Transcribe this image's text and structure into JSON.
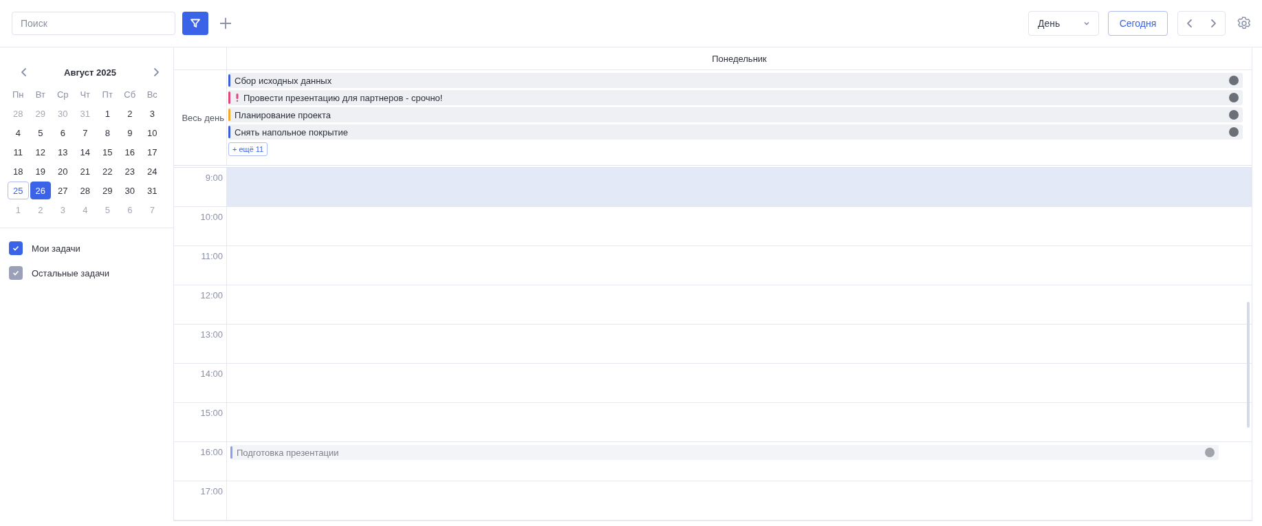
{
  "toolbar": {
    "search": {
      "placeholder": "Поиск"
    },
    "filter_active": true,
    "view_select": {
      "value": "День"
    },
    "today_button": "Сегодня"
  },
  "mini_calendar": {
    "title": "Август 2025",
    "weekdays": [
      "Пн",
      "Вт",
      "Ср",
      "Чт",
      "Пт",
      "Сб",
      "Вс"
    ],
    "weeks": [
      [
        {
          "label": "28",
          "outside": true,
          "today": false,
          "selected": false
        },
        {
          "label": "29",
          "outside": true,
          "today": false,
          "selected": false
        },
        {
          "label": "30",
          "outside": true,
          "today": false,
          "selected": false
        },
        {
          "label": "31",
          "outside": true,
          "today": false,
          "selected": false
        },
        {
          "label": "1",
          "outside": false,
          "today": false,
          "selected": false
        },
        {
          "label": "2",
          "outside": false,
          "today": false,
          "selected": false
        },
        {
          "label": "3",
          "outside": false,
          "today": false,
          "selected": false
        }
      ],
      [
        {
          "label": "4",
          "outside": false,
          "today": false,
          "selected": false
        },
        {
          "label": "5",
          "outside": false,
          "today": false,
          "selected": false
        },
        {
          "label": "6",
          "outside": false,
          "today": false,
          "selected": false
        },
        {
          "label": "7",
          "outside": false,
          "today": false,
          "selected": false
        },
        {
          "label": "8",
          "outside": false,
          "today": false,
          "selected": false
        },
        {
          "label": "9",
          "outside": false,
          "today": false,
          "selected": false
        },
        {
          "label": "10",
          "outside": false,
          "today": false,
          "selected": false
        }
      ],
      [
        {
          "label": "11",
          "outside": false,
          "today": false,
          "selected": false
        },
        {
          "label": "12",
          "outside": false,
          "today": false,
          "selected": false
        },
        {
          "label": "13",
          "outside": false,
          "today": false,
          "selected": false
        },
        {
          "label": "14",
          "outside": false,
          "today": false,
          "selected": false
        },
        {
          "label": "15",
          "outside": false,
          "today": false,
          "selected": false
        },
        {
          "label": "16",
          "outside": false,
          "today": false,
          "selected": false
        },
        {
          "label": "17",
          "outside": false,
          "today": false,
          "selected": false
        }
      ],
      [
        {
          "label": "18",
          "outside": false,
          "today": false,
          "selected": false
        },
        {
          "label": "19",
          "outside": false,
          "today": false,
          "selected": false
        },
        {
          "label": "20",
          "outside": false,
          "today": false,
          "selected": false
        },
        {
          "label": "21",
          "outside": false,
          "today": false,
          "selected": false
        },
        {
          "label": "22",
          "outside": false,
          "today": false,
          "selected": false
        },
        {
          "label": "23",
          "outside": false,
          "today": false,
          "selected": false
        },
        {
          "label": "24",
          "outside": false,
          "today": false,
          "selected": false
        }
      ],
      [
        {
          "label": "25",
          "outside": false,
          "today": true,
          "selected": false
        },
        {
          "label": "26",
          "outside": false,
          "today": false,
          "selected": true
        },
        {
          "label": "27",
          "outside": false,
          "today": false,
          "selected": false
        },
        {
          "label": "28",
          "outside": false,
          "today": false,
          "selected": false
        },
        {
          "label": "29",
          "outside": false,
          "today": false,
          "selected": false
        },
        {
          "label": "30",
          "outside": false,
          "today": false,
          "selected": false
        },
        {
          "label": "31",
          "outside": false,
          "today": false,
          "selected": false
        }
      ],
      [
        {
          "label": "1",
          "outside": true,
          "today": false,
          "selected": false
        },
        {
          "label": "2",
          "outside": true,
          "today": false,
          "selected": false
        },
        {
          "label": "3",
          "outside": true,
          "today": false,
          "selected": false
        },
        {
          "label": "4",
          "outside": true,
          "today": false,
          "selected": false
        },
        {
          "label": "5",
          "outside": true,
          "today": false,
          "selected": false
        },
        {
          "label": "6",
          "outside": true,
          "today": false,
          "selected": false
        },
        {
          "label": "7",
          "outside": true,
          "today": false,
          "selected": false
        }
      ]
    ]
  },
  "task_filters": [
    {
      "label": "Мои задачи",
      "checked": true,
      "color": "#3a63e8"
    },
    {
      "label": "Остальные задачи",
      "checked": true,
      "color": "#9aa0b8"
    }
  ],
  "day_view": {
    "day_name": "Понедельник",
    "all_day_label": "Весь день",
    "all_day_events": [
      {
        "title": "Сбор исходных данных",
        "color": "#3a5fd9",
        "urgent": false
      },
      {
        "title": "Провести презентацию для партнеров - срочно!",
        "color": "#e0457b",
        "urgent": true
      },
      {
        "title": "Планирование проекта",
        "color": "#f0a92a",
        "urgent": false
      },
      {
        "title": "Снять напольное покрытие",
        "color": "#3a5fd9",
        "urgent": false
      }
    ],
    "more_button": "+ ещё 11",
    "hours": [
      {
        "time": "9:00",
        "highlighted": true
      },
      {
        "time": "10:00",
        "highlighted": false
      },
      {
        "time": "11:00",
        "highlighted": false
      },
      {
        "time": "12:00",
        "highlighted": false
      },
      {
        "time": "13:00",
        "highlighted": false
      },
      {
        "time": "14:00",
        "highlighted": false
      },
      {
        "time": "15:00",
        "highlighted": false
      },
      {
        "time": "16:00",
        "highlighted": false,
        "events": [
          {
            "title": "Подготовка презентации",
            "color": "#8c9ef0",
            "faded": true
          }
        ]
      },
      {
        "time": "17:00",
        "highlighted": false
      }
    ]
  }
}
